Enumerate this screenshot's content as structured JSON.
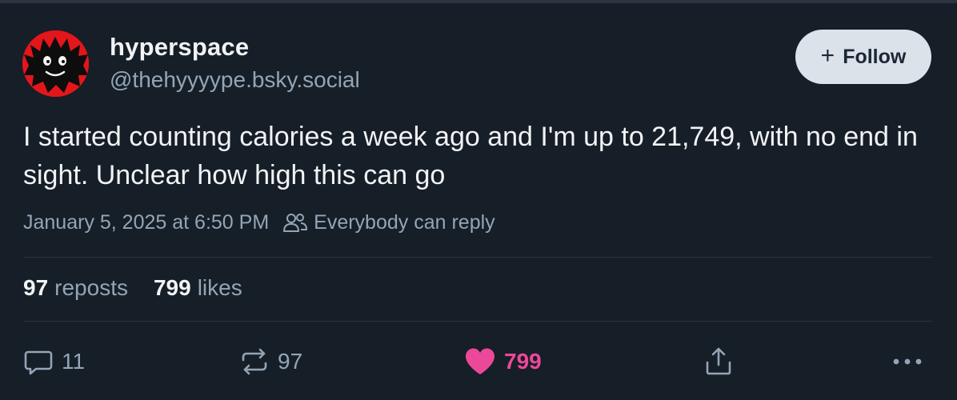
{
  "author": {
    "display_name": "hyperspace",
    "handle": "@thehyyyype.bsky.social",
    "avatar_icon": "avatar-image"
  },
  "follow_button": {
    "icon": "plus-icon",
    "label": "Follow"
  },
  "post": {
    "text": "I started counting calories a week ago and I'm up to 21,749, with no end in sight. Unclear how high this can go",
    "timestamp": "January 5, 2025 at 6:50 PM",
    "reply_setting": "Everybody can reply"
  },
  "stats": {
    "reposts_count": "97",
    "reposts_label": "reposts",
    "likes_count": "799",
    "likes_label": "likes"
  },
  "actions": {
    "reply_count": "11",
    "repost_count": "97",
    "like_count": "799"
  },
  "colors": {
    "background": "#161e27",
    "muted_text": "#93a5b7",
    "like_pink": "#ec4899",
    "follow_bg": "#dce2ea",
    "avatar_red": "#e3161b"
  }
}
